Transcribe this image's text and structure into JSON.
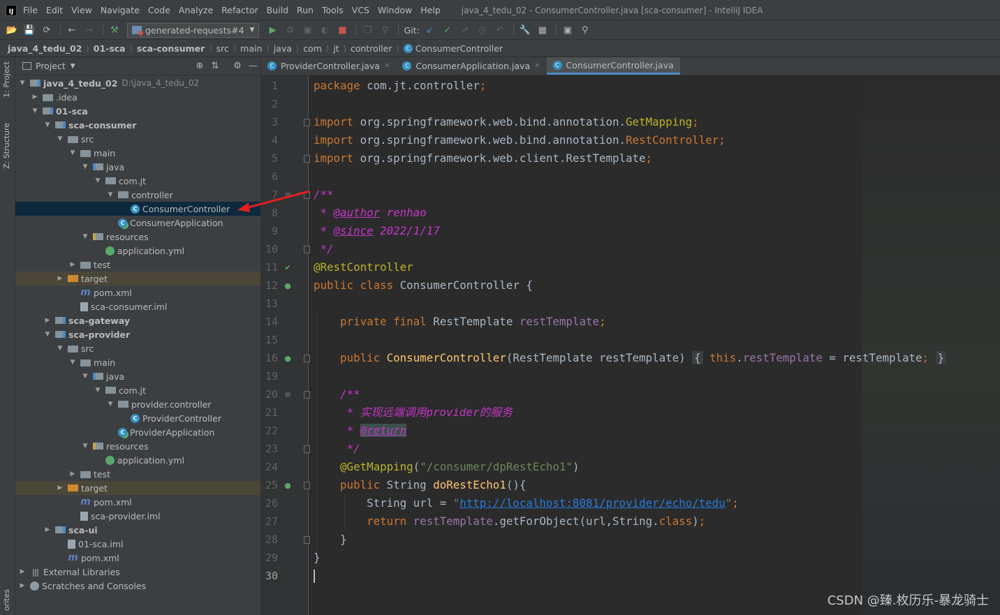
{
  "app": {
    "window_title": "java_4_tedu_02 - ConsumerController.java [sca-consumer] - IntelliJ IDEA",
    "logo_text": "IJ"
  },
  "menu": [
    "File",
    "Edit",
    "View",
    "Navigate",
    "Code",
    "Analyze",
    "Refactor",
    "Build",
    "Run",
    "Tools",
    "VCS",
    "Window",
    "Help"
  ],
  "toolbar": {
    "run_config": "generated-requests#4",
    "git_label": "Git:"
  },
  "breadcrumb": [
    "java_4_tedu_02",
    "01-sca",
    "sca-consumer",
    "src",
    "main",
    "java",
    "com",
    "jt",
    "controller",
    "ConsumerController"
  ],
  "side_stripe": {
    "project_tab": "1: Project",
    "structure_tab": "Z: Structure",
    "favorites_tab": "orites"
  },
  "project_panel": {
    "title": "Project",
    "tree": [
      {
        "label": "java_4_tedu_02",
        "path": "D:\\java_4_tedu_02",
        "depth": 0,
        "arrow": "open",
        "icon": "module",
        "bold": true
      },
      {
        "label": ".idea",
        "depth": 1,
        "arrow": "closed",
        "icon": "folder"
      },
      {
        "label": "01-sca",
        "depth": 1,
        "arrow": "open",
        "icon": "module",
        "bold": true
      },
      {
        "label": "sca-consumer",
        "depth": 2,
        "arrow": "open",
        "icon": "module",
        "bold": true
      },
      {
        "label": "src",
        "depth": 3,
        "arrow": "open",
        "icon": "folder"
      },
      {
        "label": "main",
        "depth": 4,
        "arrow": "open",
        "icon": "folder"
      },
      {
        "label": "java",
        "depth": 5,
        "arrow": "open",
        "icon": "folder-src"
      },
      {
        "label": "com.jt",
        "depth": 6,
        "arrow": "open",
        "icon": "pkg"
      },
      {
        "label": "controller",
        "depth": 7,
        "arrow": "open",
        "icon": "pkg"
      },
      {
        "label": "ConsumerController",
        "depth": 8,
        "arrow": "none",
        "icon": "cls",
        "selected": true
      },
      {
        "label": "ConsumerApplication",
        "depth": 7,
        "arrow": "none",
        "icon": "cls-app"
      },
      {
        "label": "resources",
        "depth": 5,
        "arrow": "open",
        "icon": "folder-res"
      },
      {
        "label": "application.yml",
        "depth": 6,
        "arrow": "none",
        "icon": "yml"
      },
      {
        "label": "test",
        "depth": 4,
        "arrow": "closed",
        "icon": "folder"
      },
      {
        "label": "target",
        "depth": 3,
        "arrow": "closed",
        "icon": "folder-orange",
        "target": true
      },
      {
        "label": "pom.xml",
        "depth": 4,
        "arrow": "none",
        "icon": "maven"
      },
      {
        "label": "sca-consumer.iml",
        "depth": 4,
        "arrow": "none",
        "icon": "iml"
      },
      {
        "label": "sca-gateway",
        "depth": 2,
        "arrow": "closed",
        "icon": "module",
        "bold": true
      },
      {
        "label": "sca-provider",
        "depth": 2,
        "arrow": "open",
        "icon": "module",
        "bold": true
      },
      {
        "label": "src",
        "depth": 3,
        "arrow": "open",
        "icon": "folder"
      },
      {
        "label": "main",
        "depth": 4,
        "arrow": "open",
        "icon": "folder"
      },
      {
        "label": "java",
        "depth": 5,
        "arrow": "open",
        "icon": "folder-src"
      },
      {
        "label": "com.jt",
        "depth": 6,
        "arrow": "open",
        "icon": "pkg"
      },
      {
        "label": "provider.controller",
        "depth": 7,
        "arrow": "open",
        "icon": "pkg"
      },
      {
        "label": "ProviderController",
        "depth": 8,
        "arrow": "none",
        "icon": "cls"
      },
      {
        "label": "ProviderApplication",
        "depth": 7,
        "arrow": "none",
        "icon": "cls-app"
      },
      {
        "label": "resources",
        "depth": 5,
        "arrow": "open",
        "icon": "folder-res"
      },
      {
        "label": "application.yml",
        "depth": 6,
        "arrow": "none",
        "icon": "yml"
      },
      {
        "label": "test",
        "depth": 4,
        "arrow": "closed",
        "icon": "folder"
      },
      {
        "label": "target",
        "depth": 3,
        "arrow": "closed",
        "icon": "folder-orange",
        "target": true
      },
      {
        "label": "pom.xml",
        "depth": 4,
        "arrow": "none",
        "icon": "maven"
      },
      {
        "label": "sca-provider.iml",
        "depth": 4,
        "arrow": "none",
        "icon": "iml"
      },
      {
        "label": "sca-ui",
        "depth": 2,
        "arrow": "closed",
        "icon": "module",
        "bold": true
      },
      {
        "label": "01-sca.iml",
        "depth": 3,
        "arrow": "none",
        "icon": "iml"
      },
      {
        "label": "pom.xml",
        "depth": 3,
        "arrow": "none",
        "icon": "maven"
      },
      {
        "label": "External Libraries",
        "depth": 0,
        "arrow": "closed",
        "icon": "lib"
      },
      {
        "label": "Scratches and Consoles",
        "depth": 0,
        "arrow": "closed",
        "icon": "scratch"
      }
    ]
  },
  "editor": {
    "tabs": [
      {
        "label": "ProviderController.java",
        "active": false
      },
      {
        "label": "ConsumerApplication.java",
        "active": false
      },
      {
        "label": "ConsumerController.java",
        "active": true
      }
    ],
    "line_numbers": [
      "1",
      "2",
      "3",
      "4",
      "5",
      "6",
      "7",
      "8",
      "9",
      "10",
      "11",
      "12",
      "13",
      "14",
      "15",
      "16",
      "19",
      "20",
      "21",
      "22",
      "23",
      "24",
      "25",
      "26",
      "27",
      "28",
      "29",
      "30"
    ],
    "current_line": "30",
    "lines": [
      [
        [
          "kw",
          "package "
        ],
        [
          "",
          "com.jt.controller"
        ],
        [
          "kw",
          ";"
        ]
      ],
      [],
      [
        [
          "kw",
          "import "
        ],
        [
          "",
          "org.springframework.web.bind.annotation."
        ],
        [
          "ann",
          "GetMapping"
        ],
        [
          "kw",
          ";"
        ]
      ],
      [
        [
          "kw",
          "import "
        ],
        [
          "",
          "org.springframework.web.bind.annotation."
        ],
        [
          "kw",
          "RestController"
        ],
        [
          "kw",
          ";"
        ]
      ],
      [
        [
          "kw",
          "import "
        ],
        [
          "",
          "org.springframework.web.client.RestTemplate"
        ],
        [
          "kw",
          ";"
        ]
      ],
      [],
      [
        [
          "pink",
          "/**"
        ]
      ],
      [
        [
          "pink",
          " * "
        ],
        [
          "pinktag",
          "@author"
        ],
        [
          "pink",
          " renhao"
        ]
      ],
      [
        [
          "pink",
          " * "
        ],
        [
          "pinktag",
          "@since"
        ],
        [
          "pink",
          " 2022/1/17"
        ]
      ],
      [
        [
          "pink",
          " */"
        ]
      ],
      [
        [
          "ann",
          "@RestController"
        ]
      ],
      [
        [
          "kw",
          "public class "
        ],
        [
          "",
          "ConsumerController {"
        ]
      ],
      [],
      [
        [
          "",
          "    "
        ],
        [
          "kw",
          "private final "
        ],
        [
          "",
          "RestTemplate "
        ],
        [
          "field",
          "restTemplate"
        ],
        [
          "kw",
          ";"
        ]
      ],
      [],
      [
        [
          "",
          "    "
        ],
        [
          "kw",
          "public "
        ],
        [
          "fn",
          "ConsumerController"
        ],
        [
          "",
          "(RestTemplate restTemplate) "
        ],
        [
          "fold-chip",
          "{"
        ],
        [
          "",
          " "
        ],
        [
          "kw",
          "this"
        ],
        [
          "",
          "."
        ],
        [
          "field",
          "restTemplate"
        ],
        [
          "",
          " = restTemplate"
        ],
        [
          "kw",
          ";"
        ],
        [
          "",
          " "
        ],
        [
          "fold-chip",
          "}"
        ]
      ],
      [],
      [
        [
          "",
          "    "
        ],
        [
          "pink",
          "/**"
        ]
      ],
      [
        [
          "",
          "     "
        ],
        [
          "pink",
          "* 实现远端调用provider的服务"
        ]
      ],
      [
        [
          "",
          "     "
        ],
        [
          "pink",
          "* "
        ],
        [
          "pinktag",
          "@return"
        ]
      ],
      [
        [
          "",
          "     "
        ],
        [
          "pink",
          "*/"
        ]
      ],
      [
        [
          "",
          "    "
        ],
        [
          "ann",
          "@GetMapping"
        ],
        [
          "",
          "("
        ],
        [
          "str",
          "\"/consumer/dpRestEcho1\""
        ],
        [
          "",
          ")"
        ]
      ],
      [
        [
          "",
          "    "
        ],
        [
          "kw",
          "public "
        ],
        [
          "",
          "String "
        ],
        [
          "fn",
          "doRestEcho1"
        ],
        [
          "",
          "(){"
        ]
      ],
      [
        [
          "",
          "        String url = "
        ],
        [
          "str",
          "\""
        ],
        [
          "url",
          "http://localhost:8081/provider/echo/tedu"
        ],
        [
          "str",
          "\""
        ],
        [
          "kw",
          ";"
        ]
      ],
      [
        [
          "",
          "        "
        ],
        [
          "kw",
          "return "
        ],
        [
          "field",
          "restTemplate"
        ],
        [
          "",
          ".getForObject(url,String."
        ],
        [
          "kw",
          "class"
        ],
        [
          "",
          ")"
        ],
        [
          "kw",
          ";"
        ]
      ],
      [
        [
          "",
          "    }"
        ]
      ],
      [
        [
          "",
          "}"
        ]
      ],
      [
        [
          "cursor",
          ""
        ]
      ]
    ]
  },
  "watermark": "CSDN @臻.枚历乐-暴龙骑士"
}
